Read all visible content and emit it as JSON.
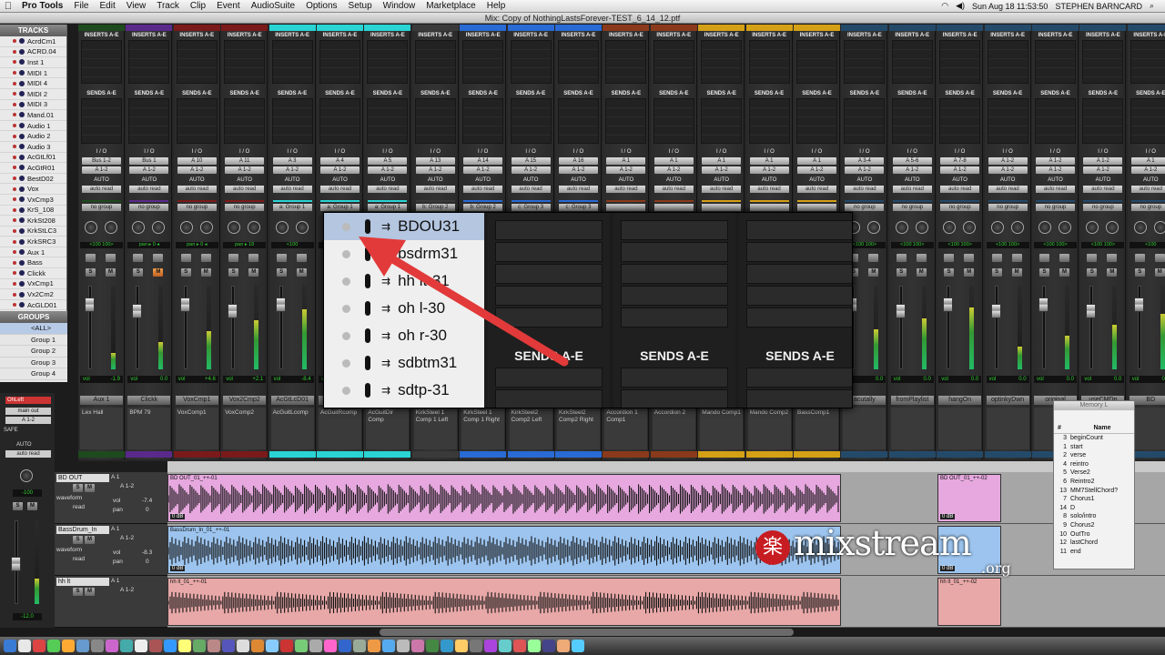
{
  "menubar": {
    "apple": "",
    "items": [
      "Pro Tools",
      "File",
      "Edit",
      "View",
      "Track",
      "Clip",
      "Event",
      "AudioSuite",
      "Options",
      "Setup",
      "Window",
      "Marketplace",
      "Help"
    ],
    "clock": "Sun Aug 18  11:53:50",
    "user": "STEPHEN BARNCARD"
  },
  "window_title": "Mix: Copy of NothingLastsForever-TEST_6_14_12.ptf",
  "tracks_panel": {
    "header": "TRACKS",
    "items": [
      "AcrdCm1",
      "ACRD.04",
      "Inst 1",
      "MIDI 1",
      "MIDI 4",
      "MIDI 2",
      "MIDI 3",
      "Mand.01",
      "Audio 1",
      "Audio 2",
      "Audio 3",
      "AcGtLf01",
      "AcGtR01",
      "BestD02",
      "Vox",
      "VxCmp3",
      "KrS_108",
      "KrkSt208",
      "KrkStLC3",
      "KrkSRC3",
      "Aux 1",
      "Bass",
      "Clickk",
      "VxCmp1",
      "Vx2Cm2",
      "AcGLD01"
    ]
  },
  "groups_panel": {
    "header": "GROUPS",
    "items": [
      "<ALL>",
      "Group 1",
      "Group 2",
      "Group 3",
      "Group 4"
    ]
  },
  "strip_labels": {
    "inserts": "INSERTS A-E",
    "sends": "SENDS A-E",
    "io": "I / O",
    "auto": "AUTO",
    "auto_read": "auto read",
    "vol": "vol",
    "pan": "pan",
    "solo": "S",
    "mute": "M",
    "dyn": "dyn"
  },
  "strips": [
    {
      "name": "Aux 1",
      "color": "#1e4a1e",
      "in": "Bus 1-2",
      "out": "A 1-2",
      "group": "no group",
      "pan": "<100  100>",
      "vol": "-1.9",
      "comment": "Lex Hall"
    },
    {
      "name": "Clickk",
      "color": "#5a2a8a",
      "in": "Bus 1",
      "out": "A 1-2",
      "group": "no group",
      "pan": "pan  ▸ 0 ◂",
      "vol": "0.0",
      "comment": "BPM 79"
    },
    {
      "name": "VoxCmp1",
      "color": "#7a1a1a",
      "in": "A 10",
      "out": "A 1-2",
      "group": "no group",
      "pan": "pan  ▸ 0 ◂",
      "vol": "+4.6",
      "comment": "VoxComp1"
    },
    {
      "name": "Vox2Cmp2",
      "color": "#7a1a1a",
      "in": "A 11",
      "out": "A 1-2",
      "group": "no group",
      "pan": "pan  ▸ 18",
      "vol": "+2.1",
      "comment": "VoxComp2"
    },
    {
      "name": "AcGtLcD01",
      "color": "#2ad4d4",
      "in": "A 3",
      "out": "A 1-2",
      "group": "a: Group 1",
      "pan": "<100",
      "vol": "-8.4",
      "comment": "AcGuitLcomp"
    },
    {
      "name": "",
      "color": "#2ad4d4",
      "in": "A 4",
      "out": "A 1-2",
      "group": "a: Group 1",
      "pan": "",
      "vol": "",
      "comment": "AcGuitRcomp"
    },
    {
      "name": "",
      "color": "#2ad4d4",
      "in": "A 5",
      "out": "A 1-2",
      "group": "a: Group 1",
      "pan": "",
      "vol": "",
      "comment": "AcGuitDir Comp"
    },
    {
      "name": "",
      "color": "#3a3a3a",
      "in": "A 13",
      "out": "A 1-2",
      "group": "b: Group 2",
      "pan": "",
      "vol": "",
      "comment": "KirkSteel 1 Comp 1 Left"
    },
    {
      "name": "",
      "color": "#2a6ad4",
      "in": "A 14",
      "out": "A 1-2",
      "group": "b: Group 2",
      "pan": "",
      "vol": "",
      "comment": "KirkSteel 1 Comp 1 Right"
    },
    {
      "name": "",
      "color": "#2a6ad4",
      "in": "A 15",
      "out": "A 1-2",
      "group": "c: Group 3",
      "pan": "",
      "vol": "",
      "comment": "KirkSteel2 Comp2 Left"
    },
    {
      "name": "",
      "color": "#2a6ad4",
      "in": "A 16",
      "out": "A 1-2",
      "group": "c: Group 3",
      "pan": "",
      "vol": "",
      "comment": "KirkSteel2 Comp2 Right"
    },
    {
      "name": "",
      "color": "#8a3a1a",
      "in": "A 1",
      "out": "A 1-2",
      "group": "",
      "pan": "",
      "vol": "",
      "comment": "Accordion 1 Comp1"
    },
    {
      "name": "",
      "color": "#8a3a1a",
      "in": "A 1",
      "out": "A 1-2",
      "group": "",
      "pan": "",
      "vol": "",
      "comment": "Accordion 2"
    },
    {
      "name": "",
      "color": "#d4a016",
      "in": "A 1",
      "out": "A 1-2",
      "group": "",
      "pan": "",
      "vol": "",
      "comment": "Mando Comp1"
    },
    {
      "name": "",
      "color": "#d4a016",
      "in": "A 1",
      "out": "A 1-2",
      "group": "",
      "pan": "",
      "vol": "",
      "comment": "Mando Comp2"
    },
    {
      "name": "",
      "color": "#d4a016",
      "in": "A 1",
      "out": "A 1-2",
      "group": "",
      "pan": "",
      "vol": "",
      "comment": "BassComp1"
    },
    {
      "name": "acutally",
      "color": "#244a6a",
      "in": "A 3-4",
      "out": "A 1-2",
      "group": "no group",
      "pan": "<100  100>",
      "vol": "0.0",
      "comment": ""
    },
    {
      "name": "fromPlaylist",
      "color": "#244a6a",
      "in": "A 5-6",
      "out": "A 1-2",
      "group": "no group",
      "pan": "<100  100>",
      "vol": "0.0",
      "comment": ""
    },
    {
      "name": "hangOn",
      "color": "#244a6a",
      "in": "A 7-8",
      "out": "A 1-2",
      "group": "no group",
      "pan": "<100  100>",
      "vol": "0.0",
      "comment": ""
    },
    {
      "name": "optinkyDwn",
      "color": "#244a6a",
      "in": "A 1-2",
      "out": "A 1-2",
      "group": "no group",
      "pan": "<100  100>",
      "vol": "0.0",
      "comment": ""
    },
    {
      "name": "original",
      "color": "#244a6a",
      "in": "A 1-2",
      "out": "A 1-2",
      "group": "no group",
      "pan": "<100  100>",
      "vol": "0.0",
      "comment": ""
    },
    {
      "name": "useCMDp",
      "color": "#244a6a",
      "in": "A 1-2",
      "out": "A 1-2",
      "group": "no group",
      "pan": "<100  100>",
      "vol": "0.0",
      "comment": ""
    },
    {
      "name": "BD",
      "color": "#244a6a",
      "in": "A 1",
      "out": "A 1-2",
      "group": "no group",
      "pan": "<100",
      "vol": "0.0",
      "comment": ""
    }
  ],
  "zoom_overlay": {
    "tracks": [
      "BDOU31",
      "bsdrm31",
      "hh lt-31",
      "oh l-30",
      "oh r-30",
      "sdbtm31",
      "sdtp-31"
    ],
    "sends_label": "SENDS A-E"
  },
  "edit_window": {
    "left_labels": {
      "oh_left": "OhLeft",
      "main_out": "main out",
      "a12": "A 1-2",
      "safe": "SAFE",
      "auto": "AUTO",
      "auto_read": "auto read",
      "vol_value": "-100",
      "bottom_value": "-12.0"
    },
    "tracks": [
      {
        "name": "BD OUT",
        "in": "A 1",
        "out": "A 1-2",
        "vol": "-7.4",
        "pan": "0",
        "mode": "waveform",
        "auto": "read",
        "clip": "BD OUT_01_++-01",
        "clip2": "BD OUT_01_++-02",
        "color": "#e6a8de",
        "db": "0 dB"
      },
      {
        "name": "BassDrum_In",
        "in": "A 1",
        "out": "A 1-2",
        "vol": "-8.3",
        "pan": "0",
        "mode": "waveform",
        "auto": "read",
        "clip": "BassDrum_In_01_++-01",
        "clip2": "",
        "color": "#9cc4ee",
        "db": "0 dB"
      },
      {
        "name": "hh lt",
        "in": "A 1",
        "out": "A 1-2",
        "vol": "",
        "pan": "",
        "mode": "",
        "auto": "",
        "clip": "hh lt_01_++-01",
        "clip2": "hh lt_01_++-02",
        "color": "#e8a8a8",
        "db": ""
      }
    ]
  },
  "memory_locations": {
    "title": "Memory L",
    "col_num": "#",
    "col_name": "Name",
    "rows": [
      {
        "n": "3",
        "name": "beginCount"
      },
      {
        "n": "1",
        "name": "start"
      },
      {
        "n": "2",
        "name": "verse"
      },
      {
        "n": "4",
        "name": "reintro"
      },
      {
        "n": "5",
        "name": "Verse2"
      },
      {
        "n": "6",
        "name": "Reintro2"
      },
      {
        "n": "13",
        "name": "MM7StellChord?"
      },
      {
        "n": "7",
        "name": "Chorus1"
      },
      {
        "n": "14",
        "name": "D"
      },
      {
        "n": "8",
        "name": "solo/intro"
      },
      {
        "n": "9",
        "name": "Chorus2"
      },
      {
        "n": "10",
        "name": "OutTro"
      },
      {
        "n": "12",
        "name": "lastChord"
      },
      {
        "n": "11",
        "name": "end"
      }
    ]
  },
  "watermark": {
    "glyph": "楽",
    "text": "mixstream",
    "tld": ".org"
  }
}
